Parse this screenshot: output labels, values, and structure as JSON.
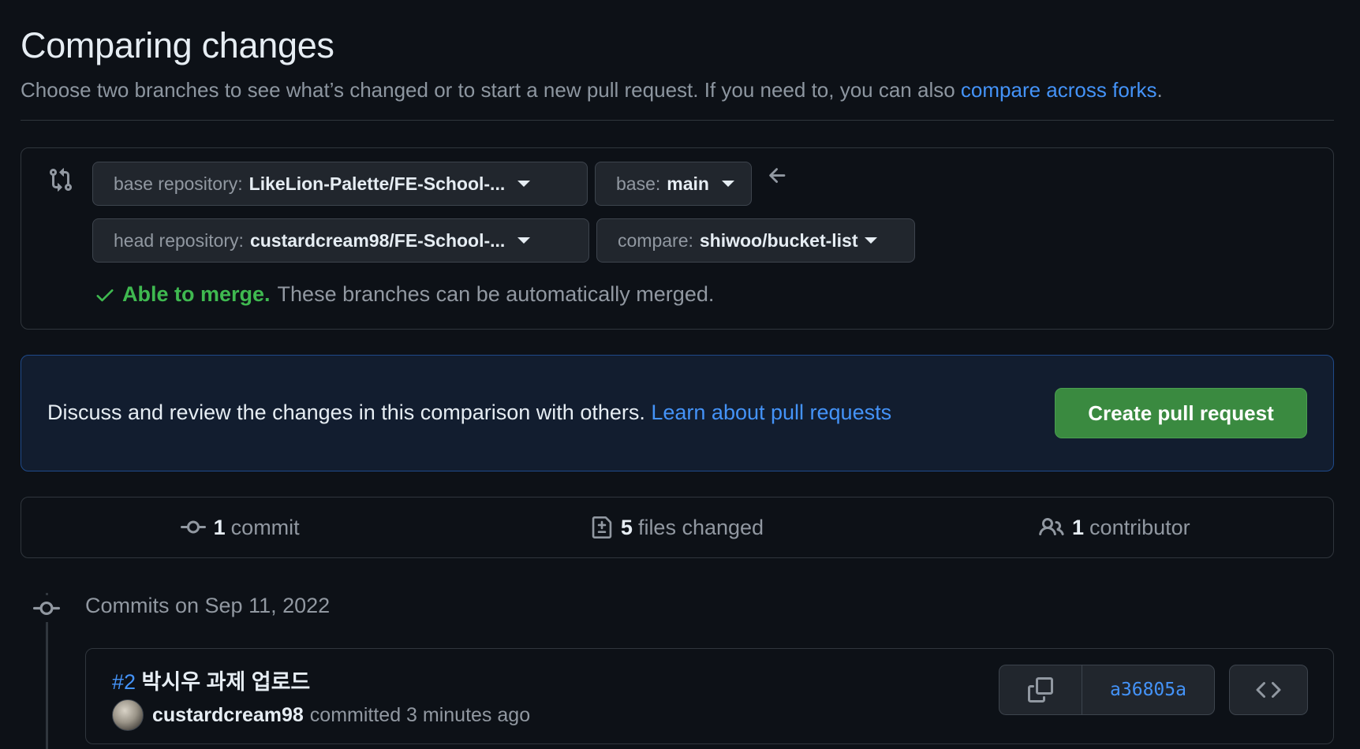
{
  "header": {
    "title": "Comparing changes",
    "subtitle_text": "Choose two branches to see what’s changed or to start a new pull request. If you need to, you can also ",
    "subtitle_link": "compare across forks",
    "subtitle_end": "."
  },
  "range": {
    "base_repo_label": "base repository:",
    "base_repo_value": "LikeLion-Palette/FE-School-...",
    "base_label": "base:",
    "base_value": "main",
    "head_repo_label": "head repository:",
    "head_repo_value": "custardcream98/FE-School-...",
    "compare_label": "compare:",
    "compare_value": "shiwoo/bucket-list",
    "merge_ok": "Able to merge.",
    "merge_msg": "These branches can be automatically merged."
  },
  "discuss": {
    "text": "Discuss and review the changes in this comparison with others. ",
    "link": "Learn about pull requests",
    "create_button": "Create pull request"
  },
  "stats": {
    "commits_count": "1",
    "commits_label": "commit",
    "files_count": "5",
    "files_label": "files changed",
    "contributors_count": "1",
    "contributors_label": "contributor"
  },
  "commits": {
    "date_header": "Commits on Sep 11, 2022",
    "items": [
      {
        "pr_ref": "#2",
        "message": " 박시우 과제 업로드",
        "author": "custardcream98",
        "action": "committed 3 minutes ago",
        "sha": "a36805a"
      }
    ]
  },
  "icons": {
    "compare": "git-compare-icon",
    "arrow": "arrow-left-icon",
    "check": "check-icon",
    "commit": "git-commit-icon",
    "diff": "file-diff-icon",
    "people": "people-icon",
    "copy": "copy-icon",
    "code": "code-icon"
  },
  "colors": {
    "background": "#0d1117",
    "accent_link": "#4493f8",
    "success": "#3fb950",
    "primary_button": "#3a8a40"
  }
}
